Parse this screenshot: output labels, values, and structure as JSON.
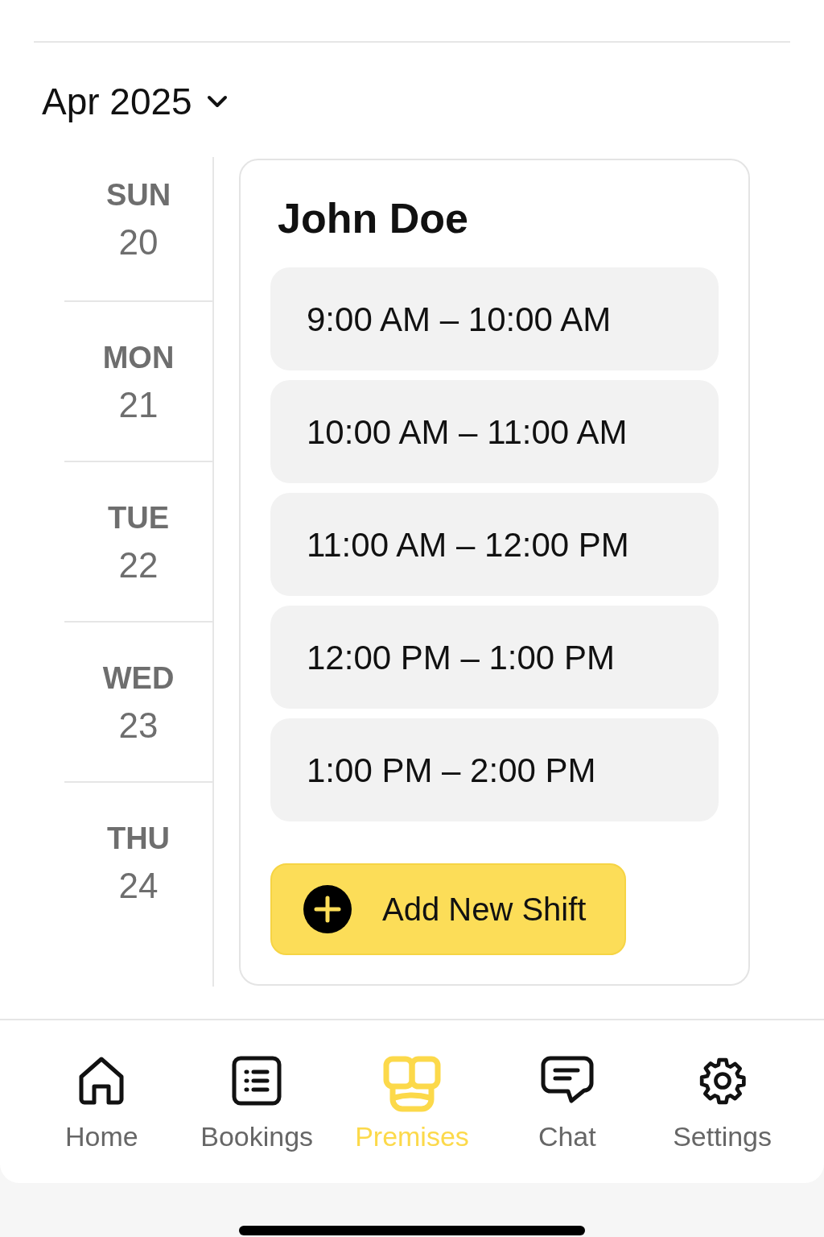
{
  "header": {
    "month": "Apr 2025"
  },
  "days": [
    {
      "weekday": "SUN",
      "date": "20"
    },
    {
      "weekday": "MON",
      "date": "21"
    },
    {
      "weekday": "TUE",
      "date": "22"
    },
    {
      "weekday": "WED",
      "date": "23"
    },
    {
      "weekday": "THU",
      "date": "24"
    }
  ],
  "staff": {
    "name": "John Doe",
    "shifts": [
      "9:00 AM – 10:00 AM",
      "10:00 AM – 11:00 AM",
      "11:00 AM – 12:00 PM",
      "12:00 PM – 1:00 PM",
      "1:00 PM – 2:00 PM"
    ]
  },
  "add_button": {
    "label": "Add New Shift"
  },
  "nav": [
    {
      "label": "Home",
      "selected": false
    },
    {
      "label": "Bookings",
      "selected": false
    },
    {
      "label": "Premises",
      "selected": true
    },
    {
      "label": "Chat",
      "selected": false
    },
    {
      "label": "Settings",
      "selected": false
    }
  ]
}
